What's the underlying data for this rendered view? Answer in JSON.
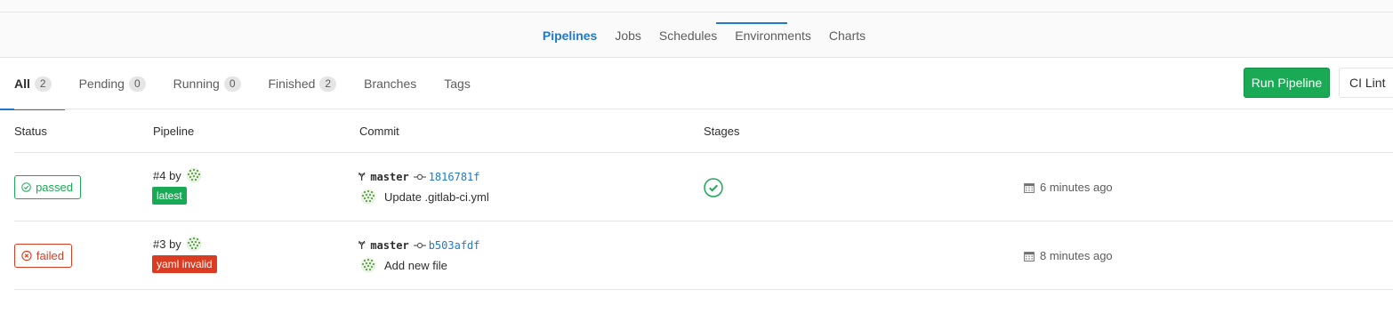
{
  "subnav": {
    "items": [
      {
        "label": "Pipelines",
        "active": true
      },
      {
        "label": "Jobs"
      },
      {
        "label": "Schedules"
      },
      {
        "label": "Environments"
      },
      {
        "label": "Charts"
      }
    ]
  },
  "scope_tabs": [
    {
      "label": "All",
      "count": "2",
      "active": true
    },
    {
      "label": "Pending",
      "count": "0"
    },
    {
      "label": "Running",
      "count": "0"
    },
    {
      "label": "Finished",
      "count": "2"
    },
    {
      "label": "Branches"
    },
    {
      "label": "Tags"
    }
  ],
  "actions": {
    "run_pipeline_label": "Run Pipeline",
    "ci_lint_label": "CI Lint"
  },
  "table": {
    "headers": {
      "status": "Status",
      "pipeline": "Pipeline",
      "commit": "Commit",
      "stages": "Stages"
    },
    "rows": [
      {
        "status": "passed",
        "pipeline_id": "#4 by",
        "label": "latest",
        "branch": "master",
        "sha": "1816781f",
        "commit_title": "Update .gitlab-ci.yml",
        "stage_icon": "check-circle-icon",
        "time": "6 minutes ago"
      },
      {
        "status": "failed",
        "pipeline_id": "#3 by",
        "label": "yaml invalid",
        "branch": "master",
        "sha": "b503afdf",
        "commit_title": "Add new file",
        "time": "8 minutes ago"
      }
    ]
  },
  "colors": {
    "accent_blue": "#1f78d1",
    "success_green": "#1aaa55",
    "danger_red": "#db3b21"
  }
}
